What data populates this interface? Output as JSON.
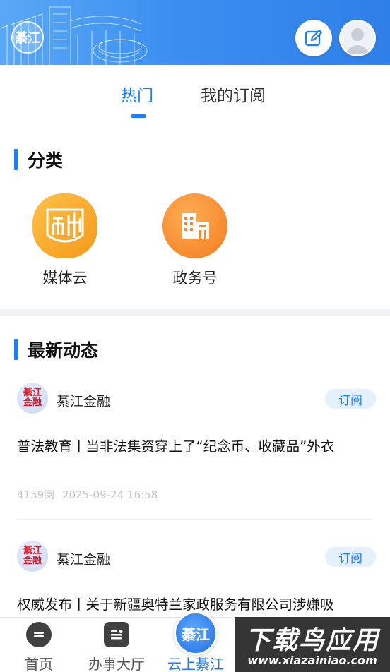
{
  "header": {
    "logo_text": "綦江",
    "edit_icon": "edit-icon",
    "avatar_icon": "user-avatar-icon",
    "brand_color": "#3a8ff0"
  },
  "tabs": [
    {
      "label": "热门",
      "active": true
    },
    {
      "label": "我的订阅",
      "active": false
    }
  ],
  "categories_section": {
    "title": "分类",
    "items": [
      {
        "label": "媒体云",
        "icon": "media-cloud-icon",
        "color": "#f5a623"
      },
      {
        "label": "政务号",
        "icon": "government-building-icon",
        "color": "#f48a2a"
      }
    ]
  },
  "latest_section": {
    "title": "最新动态",
    "items": [
      {
        "source": "綦江金融",
        "avatar_text": "綦江金融",
        "subscribe_label": "订阅",
        "title": "普法教育丨当非法集资穿上了“纪念币、收藏品”外衣",
        "views": "4159阅",
        "time": "2025-09-24 16:58"
      },
      {
        "source": "綦江金融",
        "avatar_text": "綦江金融",
        "subscribe_label": "订阅",
        "title": "权威发布丨关于新疆奥特兰家政服务有限公司涉嫌吸"
      }
    ]
  },
  "bottom_nav": {
    "items": [
      {
        "label": "首页",
        "icon": "home-icon",
        "active": false
      },
      {
        "label": "办事大厅",
        "icon": "service-hall-icon",
        "active": false
      },
      {
        "label": "云上綦江",
        "icon": "cloud-qijiang-logo-icon",
        "active": true
      }
    ],
    "center_logo_text": "綦江"
  },
  "watermark": {
    "main": "下载鸟应用",
    "sub": "www.xiazainiao.com"
  }
}
